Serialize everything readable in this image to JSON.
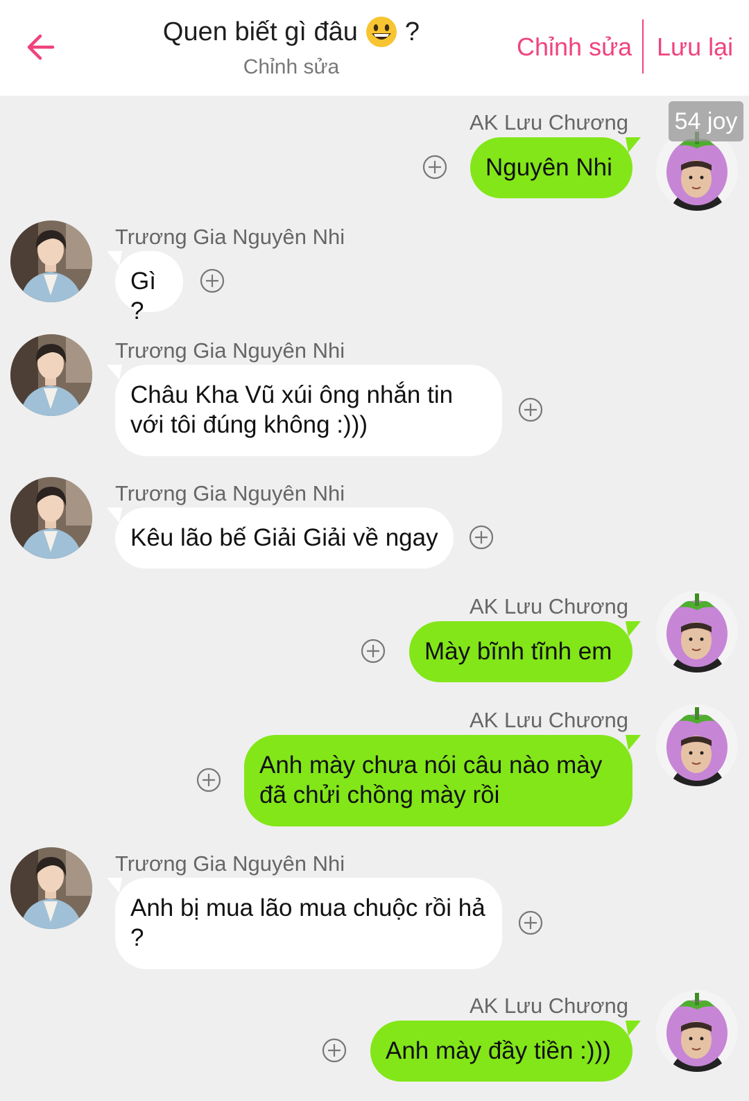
{
  "header": {
    "title": "Quen biết gì đâu",
    "title_suffix": "?",
    "subtitle": "Chỉnh sửa",
    "edit_label": "Chỉnh sửa",
    "save_label": "Lưu lại",
    "back_icon": "arrow-left-icon",
    "title_emoji": "grinning-face-emoji-icon",
    "accent_color": "#f0437d"
  },
  "badge": {
    "text": "54 joy"
  },
  "colors": {
    "background": "#efefef",
    "sent_bubble": "#82e619",
    "received_bubble": "#ffffff"
  },
  "messages": [
    {
      "side": "right",
      "sender": "AK Lưu Chương",
      "text": "Nguyên Nhi"
    },
    {
      "side": "left",
      "sender": "Trương Gia Nguyên Nhi",
      "text": "Gì ?"
    },
    {
      "side": "left",
      "sender": "Trương Gia Nguyên Nhi",
      "text": "Châu Kha Vũ xúi ông nhắn tin với tôi đúng không :)))"
    },
    {
      "side": "left",
      "sender": "Trương Gia Nguyên Nhi",
      "text": "Kêu lão bế Giải Giải về ngay"
    },
    {
      "side": "right",
      "sender": "AK Lưu Chương",
      "text": "Mày bĩnh tĩnh em"
    },
    {
      "side": "right",
      "sender": "AK Lưu Chương",
      "text": "Anh mày chưa nói câu nào mày đã chửi chồng mày rồi"
    },
    {
      "side": "left",
      "sender": "Trương Gia Nguyên Nhi",
      "text": "Anh bị mua lão mua chuộc rồi hả ?"
    },
    {
      "side": "right",
      "sender": "AK Lưu Chương",
      "text": "Anh mày đầy tiền :)))"
    }
  ]
}
